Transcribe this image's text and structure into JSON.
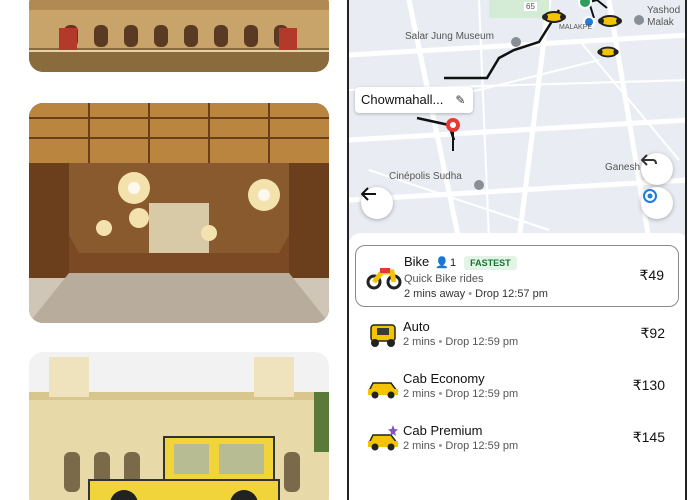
{
  "photos": [
    {
      "icon": "palace-facade-photo"
    },
    {
      "icon": "palace-chandelier-hall-photo"
    },
    {
      "icon": "palace-vintage-car-photo"
    }
  ],
  "map": {
    "labels": {
      "salar_jung": "Salar Jung Museum",
      "malakpet": "MALAKPE",
      "yashoda": "Yashod",
      "malak": "- Malak",
      "cinepolis": "Cinépolis Sudha",
      "ganesh": "Ganesh",
      "road_number": "65"
    },
    "pickup_name": "Chowmahall...",
    "back_icon": "arrow-left-icon",
    "recenter_icon": "target-icon",
    "share_icon": "share-arrow-icon"
  },
  "rides": [
    {
      "name": "Bike",
      "passengers": "1",
      "badge": "FASTEST",
      "desc": "Quick Bike rides",
      "eta": "2 mins away",
      "drop": "Drop 12:57 pm",
      "price": "₹49",
      "icon": "bike-icon",
      "selected": true
    },
    {
      "name": "Auto",
      "eta": "2 mins",
      "drop": "Drop 12:59 pm",
      "price": "₹92",
      "icon": "auto-rickshaw-icon"
    },
    {
      "name": "Cab Economy",
      "eta": "2 mins",
      "drop": "Drop 12:59 pm",
      "price": "₹130",
      "icon": "cab-icon"
    },
    {
      "name": "Cab Premium",
      "eta": "2 mins",
      "drop": "Drop 12:59 pm",
      "price": "₹145",
      "icon": "cab-premium-icon"
    }
  ],
  "colors": {
    "accent_green": "#1b6f33",
    "pin_red": "#e53935",
    "bike_yellow": "#f5c400",
    "user_blue": "#1e7be0"
  }
}
